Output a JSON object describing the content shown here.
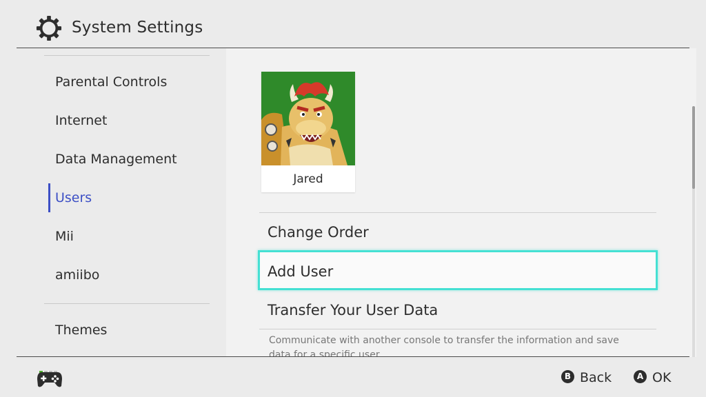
{
  "header": {
    "title": "System Settings",
    "icon": "gear-icon"
  },
  "sidebar": {
    "items": [
      {
        "label": "Parental Controls"
      },
      {
        "label": "Internet"
      },
      {
        "label": "Data Management"
      },
      {
        "label": "Users",
        "active": true
      },
      {
        "label": "Mii"
      },
      {
        "label": "amiibo"
      },
      {
        "label": "Themes"
      }
    ]
  },
  "main": {
    "user": {
      "name": "Jared"
    },
    "options": [
      {
        "label": "Change Order"
      },
      {
        "label": "Add User",
        "selected": true
      },
      {
        "label": "Transfer Your User Data"
      }
    ],
    "description": "Communicate with another console to transfer the information and save data for a specific user."
  },
  "footer": {
    "back": {
      "button": "B",
      "label": "Back"
    },
    "ok": {
      "button": "A",
      "label": "OK"
    }
  },
  "colors": {
    "accent": "#3c4fc5",
    "selection": "#45e0d3",
    "indicator": "#4caf2a"
  }
}
